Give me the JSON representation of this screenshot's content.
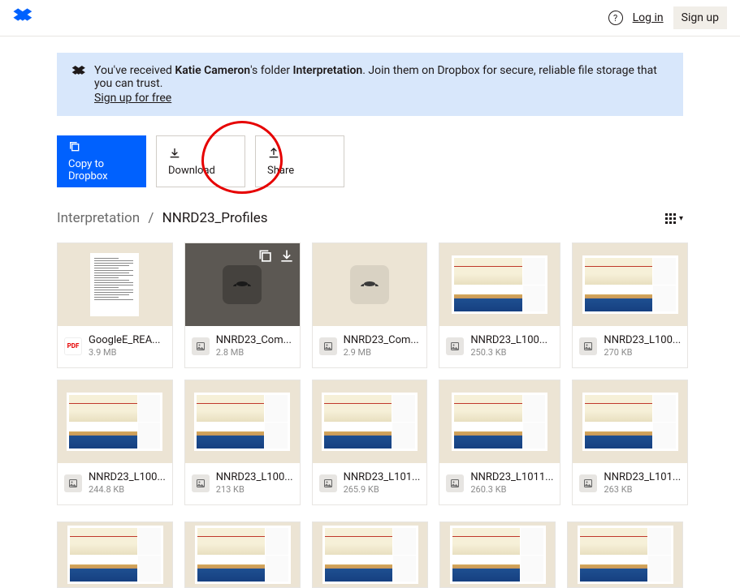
{
  "header": {
    "help_tooltip": "?",
    "login": "Log in",
    "signup": "Sign up"
  },
  "banner": {
    "prefix": "You've received ",
    "sender": "Katie Cameron",
    "mid": "'s folder ",
    "folder": "Interpretation",
    "suffix": ". Join them on Dropbox for secure, reliable file storage that you can trust.",
    "cta": "Sign up for free"
  },
  "actions": {
    "copy": "Copy to Dropbox",
    "download": "Download",
    "share": "Share"
  },
  "breadcrumb": {
    "parent": "Interpretation",
    "sep": "/",
    "current": "NNRD23_Profiles"
  },
  "files": [
    {
      "name": "GoogleE_REA...",
      "size": "3.9 MB",
      "kind": "pdf",
      "thumb": "doc"
    },
    {
      "name": "NNRD23_Com...",
      "size": "2.8 MB",
      "kind": "img",
      "thumb": "ph-dark",
      "hovered": true
    },
    {
      "name": "NNRD23_Com...",
      "size": "2.9 MB",
      "kind": "img",
      "thumb": "ph-light"
    },
    {
      "name": "NNRD23_L100...",
      "size": "250.3 KB",
      "kind": "img",
      "thumb": "profile"
    },
    {
      "name": "NNRD23_L100...",
      "size": "270 KB",
      "kind": "img",
      "thumb": "profile"
    },
    {
      "name": "NNRD23_L100...",
      "size": "244.8 KB",
      "kind": "img",
      "thumb": "profile"
    },
    {
      "name": "NNRD23_L100...",
      "size": "213 KB",
      "kind": "img",
      "thumb": "profile"
    },
    {
      "name": "NNRD23_L101...",
      "size": "265.9 KB",
      "kind": "img",
      "thumb": "profile"
    },
    {
      "name": "NNRD23_L1011...",
      "size": "260.3 KB",
      "kind": "img",
      "thumb": "profile"
    },
    {
      "name": "NNRD23_L101...",
      "size": "263 KB",
      "kind": "img",
      "thumb": "profile"
    }
  ],
  "icon_labels": {
    "pdf": "PDF"
  }
}
